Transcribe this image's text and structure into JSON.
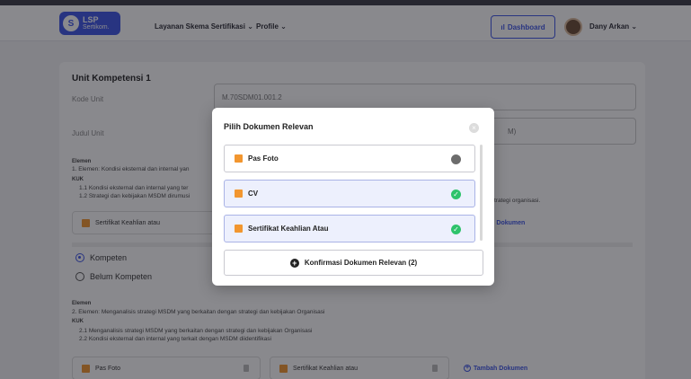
{
  "navbar": {
    "logo_title": "LSP",
    "logo_subtitle": "Sertikom.",
    "menu_layanan": "Layanan Skema Sertifikasi",
    "menu_profile": "Profile",
    "dashboard_label": "Dashboard",
    "user_name": "Dany Arkan"
  },
  "unit": {
    "title": "Unit Kompetensi 1",
    "kode_label": "Kode Unit",
    "kode_value": "M.70SDM01.001.2",
    "judul_label": "Judul Unit",
    "judul_value_visible": "M)",
    "elemen_label": "Elemen",
    "elemen_1": "1. Elemen: Kondisi eksternal dan internal yan",
    "kuk_label": "KUK",
    "kuk_1_1": "1.1  Kondisi eksternal dan internal yang ter",
    "kuk_1_2": "1.2  Strategi dan kebijakan MSDM dirumusi",
    "kuk_1_2_tail": "trategi organisasi.",
    "doc_chip_1": "Sertifikat Keahlian atau",
    "add_doc_partial": "bah Dokumen",
    "radio_kompeten": "Kompeten",
    "radio_belum": "Belum Kompeten",
    "elemen_label_2": "Elemen",
    "elemen_2": "2. Elemen: Menganalisis strategi MSDM yang berkaitan dengan strategi dan kebijakan Organisasi",
    "kuk_label_2": "KUK",
    "kuk_2_1": "2.1  Menganalisis strategi MSDM yang berkaitan dengan strategi dan kebijakan Organisasi",
    "kuk_2_2": "2.2  Kondisi eksternal dan internal yang terkait dengan MSDM diidentifikasi",
    "doc_chip_2": "Pas Foto",
    "doc_chip_3": "Sertifikat Keahlian atau",
    "add_doc": "Tambah Dokumen"
  },
  "modal": {
    "title": "Pilih Dokumen Relevan",
    "documents": [
      {
        "label": "Pas Foto",
        "selected": false
      },
      {
        "label": "CV",
        "selected": true
      },
      {
        "label": "Sertifikat Keahlian Atau",
        "selected": true
      }
    ],
    "confirm_label": "Konfirmasi Dokumen Relevan (2)"
  },
  "colors": {
    "brand": "#3c55e6",
    "selected_bg": "#edf0fd",
    "check": "#2ec36b",
    "doc_icon": "#f2962f"
  }
}
